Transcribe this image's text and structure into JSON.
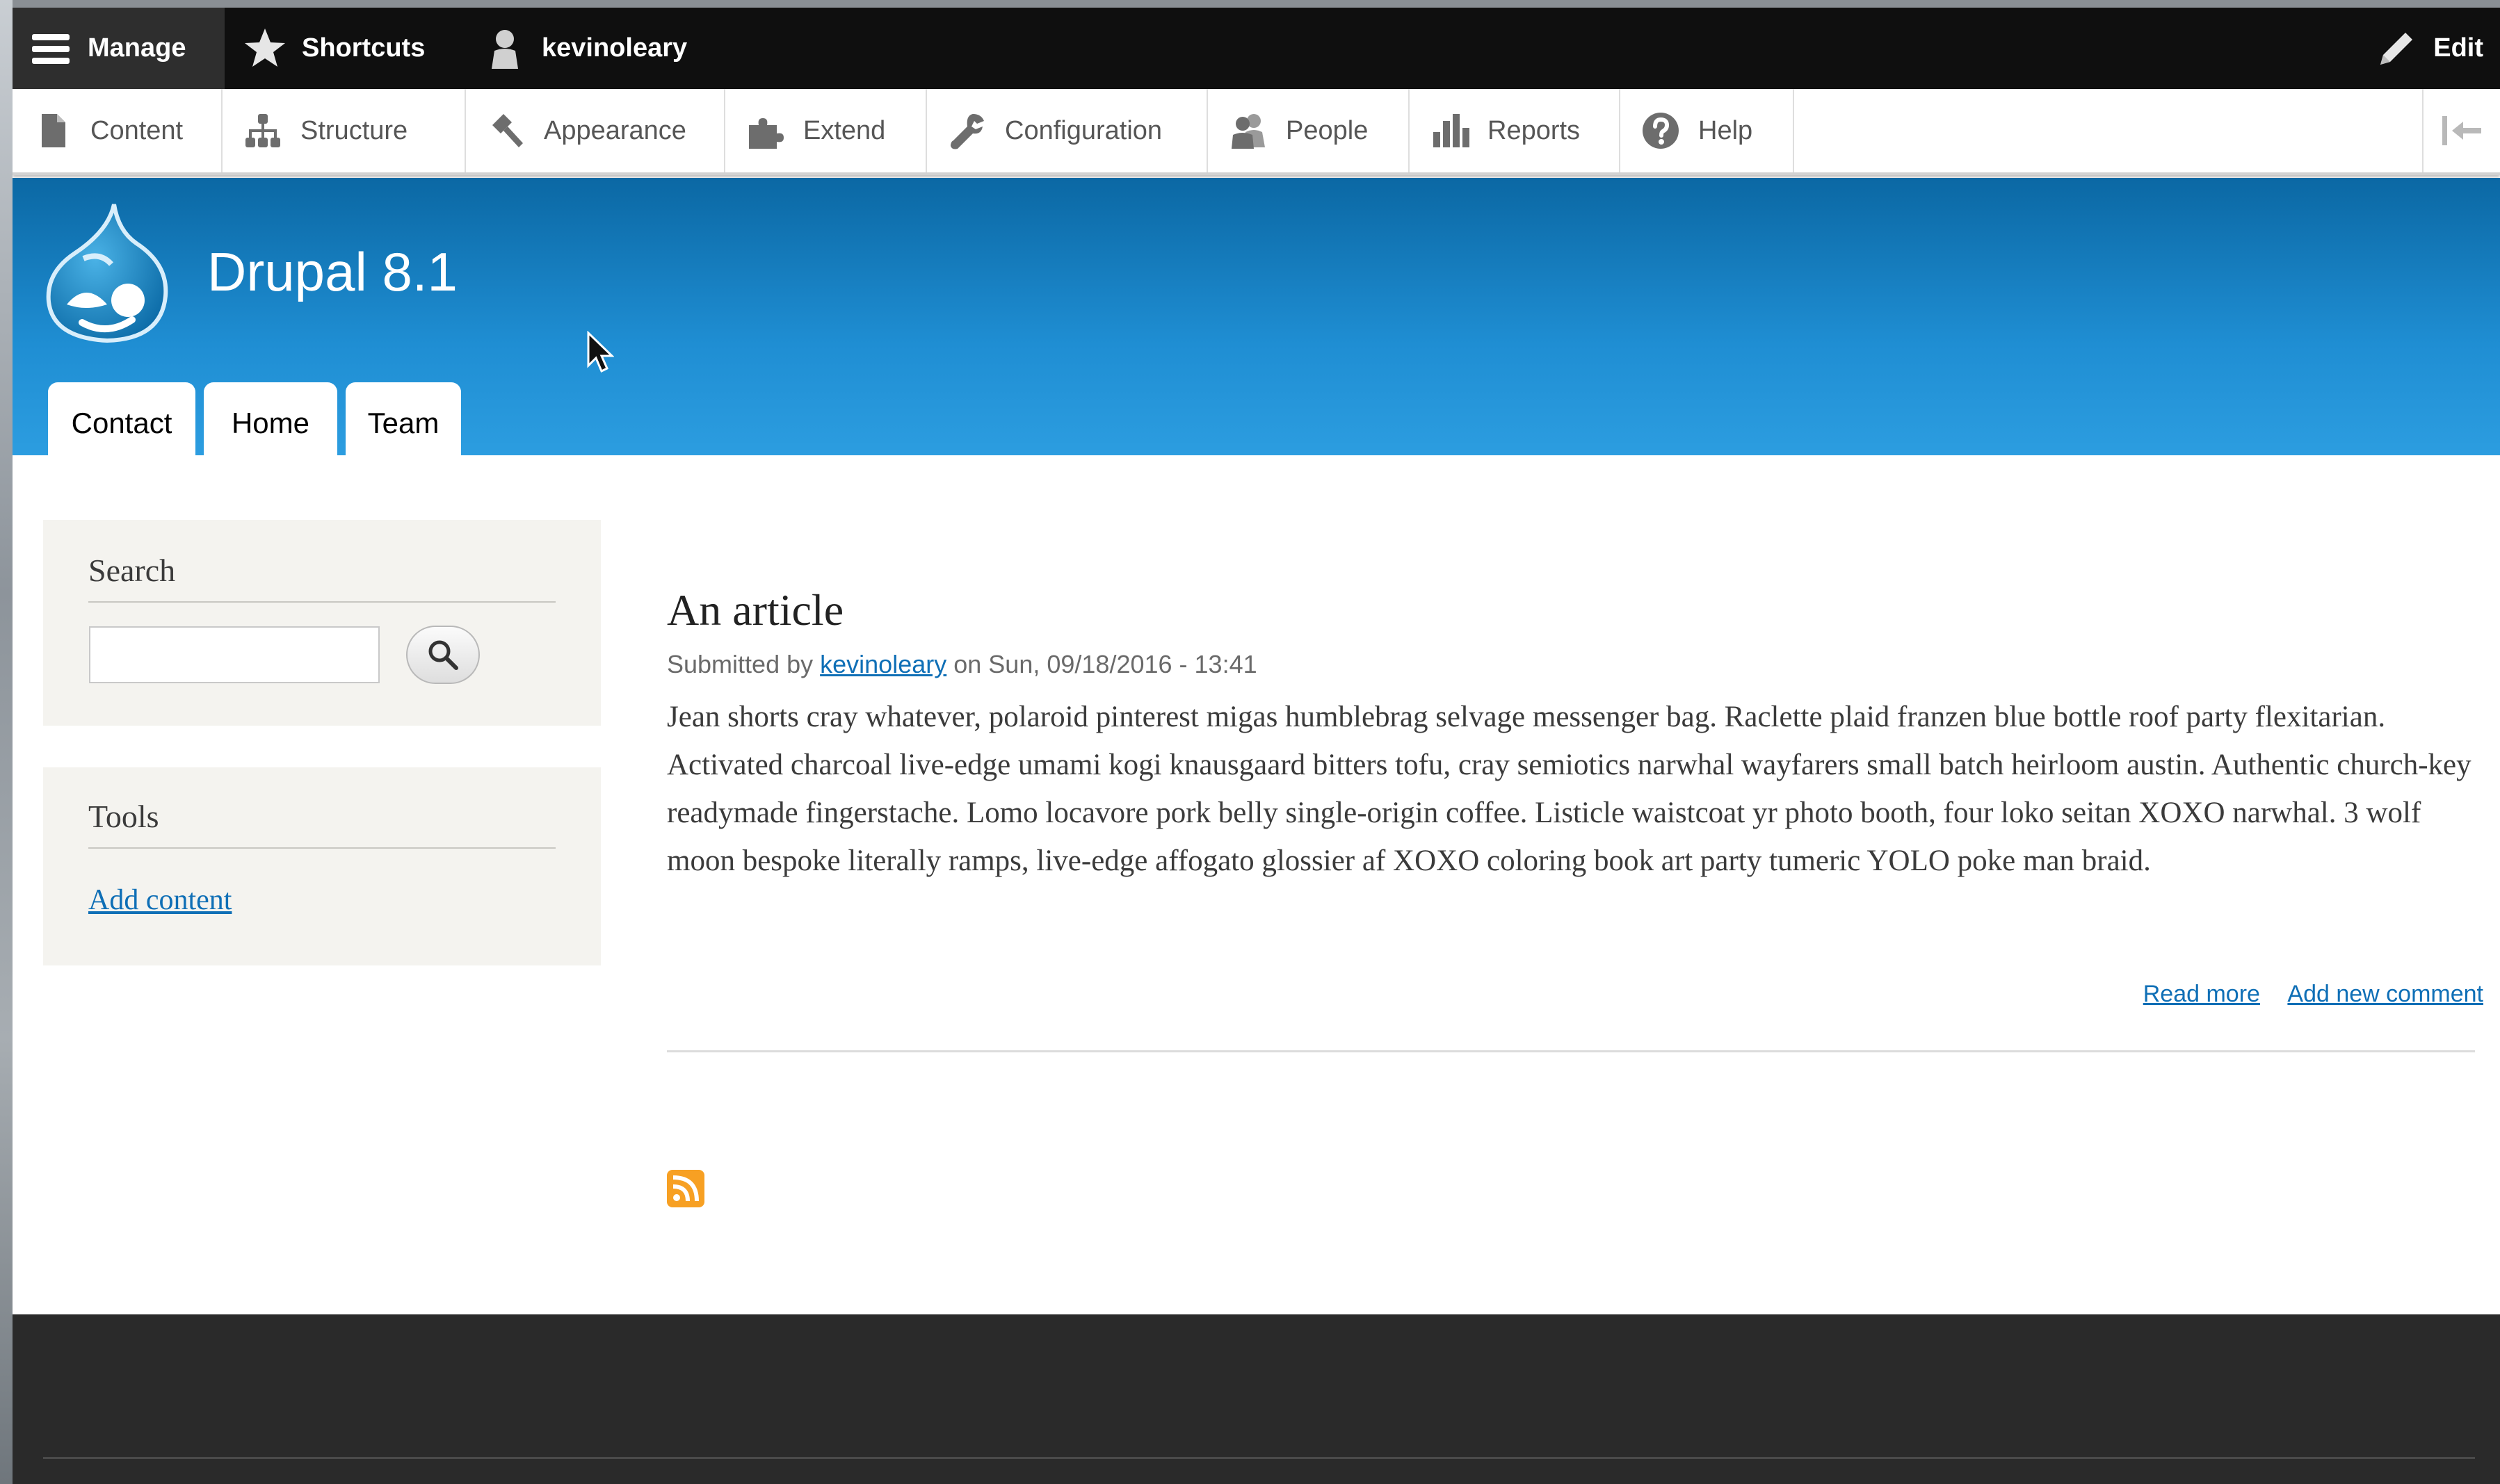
{
  "toolbar": {
    "manage_label": "Manage",
    "shortcuts_label": "Shortcuts",
    "user_label": "kevinoleary",
    "edit_label": "Edit"
  },
  "tray": {
    "items": [
      {
        "label": "Content",
        "icon": "file-icon"
      },
      {
        "label": "Structure",
        "icon": "sitemap-icon"
      },
      {
        "label": "Appearance",
        "icon": "paintbrush-icon"
      },
      {
        "label": "Extend",
        "icon": "puzzle-icon"
      },
      {
        "label": "Configuration",
        "icon": "wrench-icon"
      },
      {
        "label": "People",
        "icon": "people-icon"
      },
      {
        "label": "Reports",
        "icon": "bar-chart-icon"
      },
      {
        "label": "Help",
        "icon": "help-icon"
      }
    ]
  },
  "header": {
    "site_name": "Drupal 8.1",
    "tabs": [
      {
        "label": "Contact"
      },
      {
        "label": "Home"
      },
      {
        "label": "Team"
      }
    ]
  },
  "sidebar": {
    "search": {
      "title": "Search",
      "input_value": "",
      "placeholder": ""
    },
    "tools": {
      "title": "Tools",
      "link": "Add content"
    }
  },
  "article": {
    "title": "An article",
    "submitted_prefix": "Submitted by",
    "author": "kevinoleary",
    "date": "on Sun, 09/18/2016 - 13:41",
    "body": "Jean shorts cray whatever, polaroid pinterest migas humblebrag selvage messenger bag. Raclette plaid franzen blue bottle roof party flexitarian. Activated charcoal live-edge umami kogi knausgaard bitters tofu, cray semiotics narwhal wayfarers small batch heirloom austin. Authentic church-key readymade fingerstache. Lomo locavore pork belly single-origin coffee. Listicle waistcoat yr photo booth, four loko seitan XOXO narwhal. 3 wolf moon bespoke literally ramps, live-edge affogato glossier af XOXO coloring book art party tumeric YOLO poke man braid.",
    "read_more": "Read more",
    "add_comment": "Add new comment"
  },
  "colors": {
    "header_blue_top": "#0b68a4",
    "header_blue_bottom": "#2c9de0",
    "link_blue": "#0f6fb6",
    "footer": "#2a2a2a",
    "rss_orange": "#f7a023"
  }
}
